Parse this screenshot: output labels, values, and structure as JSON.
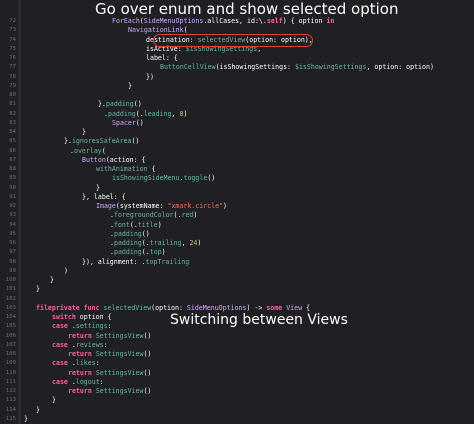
{
  "annotations": {
    "top": "Go over enum and show selected option",
    "middle": "Switching between Views"
  },
  "colors": {
    "background": "#1f1f24",
    "keyword": "#fc5fa3",
    "type": "#d0a8ff",
    "function": "#67b7a4",
    "string": "#fc6a5d",
    "number": "#d0bf69",
    "highlight": "#e0412f"
  },
  "lines": [
    {
      "n": "72",
      "tokens": [
        {
          "t": "ForEach",
          "c": "ty"
        },
        {
          "t": "(",
          "c": "pl"
        },
        {
          "t": "SideMenuOptions",
          "c": "ty"
        },
        {
          "t": ".allCases, id:\\.",
          "c": "pl"
        },
        {
          "t": "self",
          "c": "kw"
        },
        {
          "t": ") { option ",
          "c": "pl"
        },
        {
          "t": "in",
          "c": "kw"
        }
      ]
    },
    {
      "n": "73",
      "tokens": [
        {
          "t": "NavigationLink",
          "c": "ty"
        },
        {
          "t": "(",
          "c": "pl"
        }
      ]
    },
    {
      "n": "74",
      "tokens": [
        {
          "t": "destination",
          "c": "pl"
        },
        {
          "t": ": ",
          "c": "pl"
        },
        {
          "t": "selectedView",
          "c": "fn"
        },
        {
          "t": "(option: option),",
          "c": "pl"
        }
      ]
    },
    {
      "n": "75",
      "tokens": [
        {
          "t": "isActive",
          "c": "pl"
        },
        {
          "t": ": ",
          "c": "pl"
        },
        {
          "t": "$isShowingSettings",
          "c": "fn"
        },
        {
          "t": ",",
          "c": "pl"
        }
      ]
    },
    {
      "n": "76",
      "tokens": [
        {
          "t": "label",
          "c": "pl"
        },
        {
          "t": ": {",
          "c": "pl"
        }
      ]
    },
    {
      "n": "77",
      "tokens": [
        {
          "t": "ButtonCellView",
          "c": "fn"
        },
        {
          "t": "(isShowingSettings: ",
          "c": "pl"
        },
        {
          "t": "$isShowingSettings",
          "c": "fn"
        },
        {
          "t": ", option: option)",
          "c": "pl"
        }
      ]
    },
    {
      "n": "78",
      "tokens": [
        {
          "t": "})",
          "c": "pl"
        }
      ]
    },
    {
      "n": "79",
      "tokens": [
        {
          "t": "}",
          "c": "pl"
        }
      ]
    },
    {
      "n": "80",
      "tokens": []
    },
    {
      "n": "81",
      "tokens": [
        {
          "t": "}.",
          "c": "pl"
        },
        {
          "t": "padding",
          "c": "fn"
        },
        {
          "t": "()",
          "c": "pl"
        }
      ]
    },
    {
      "n": "82",
      "tokens": [
        {
          "t": ".",
          "c": "pl"
        },
        {
          "t": "padding",
          "c": "fn"
        },
        {
          "t": "(.",
          "c": "pl"
        },
        {
          "t": "leading",
          "c": "fn"
        },
        {
          "t": ", ",
          "c": "pl"
        },
        {
          "t": "0",
          "c": "nm"
        },
        {
          "t": ")",
          "c": "pl"
        }
      ]
    },
    {
      "n": "83",
      "tokens": [
        {
          "t": "Spacer",
          "c": "ty"
        },
        {
          "t": "()",
          "c": "pl"
        }
      ]
    },
    {
      "n": "84",
      "tokens": [
        {
          "t": "}",
          "c": "pl"
        }
      ]
    },
    {
      "n": "85",
      "tokens": [
        {
          "t": "}.",
          "c": "pl"
        },
        {
          "t": "ignoresSafeArea",
          "c": "fn"
        },
        {
          "t": "()",
          "c": "pl"
        }
      ]
    },
    {
      "n": "86",
      "tokens": [
        {
          "t": ".",
          "c": "pl"
        },
        {
          "t": "overlay",
          "c": "fn"
        },
        {
          "t": "(",
          "c": "pl"
        }
      ]
    },
    {
      "n": "87",
      "tokens": [
        {
          "t": "Button",
          "c": "ty"
        },
        {
          "t": "(action: {",
          "c": "pl"
        }
      ]
    },
    {
      "n": "88",
      "tokens": [
        {
          "t": "withAnimation",
          "c": "fn"
        },
        {
          "t": " {",
          "c": "pl"
        }
      ]
    },
    {
      "n": "89",
      "tokens": [
        {
          "t": "isShowingSideMenu",
          "c": "fn"
        },
        {
          "t": ".",
          "c": "pl"
        },
        {
          "t": "toggle",
          "c": "fn"
        },
        {
          "t": "()",
          "c": "pl"
        }
      ]
    },
    {
      "n": "90",
      "tokens": [
        {
          "t": "}",
          "c": "pl"
        }
      ]
    },
    {
      "n": "91",
      "tokens": [
        {
          "t": "}, label: {",
          "c": "pl"
        }
      ]
    },
    {
      "n": "92",
      "tokens": [
        {
          "t": "Image",
          "c": "ty"
        },
        {
          "t": "(systemName: ",
          "c": "pl"
        },
        {
          "t": "\"xmark.circle\"",
          "c": "st"
        },
        {
          "t": ")",
          "c": "pl"
        }
      ]
    },
    {
      "n": "93",
      "tokens": [
        {
          "t": ".",
          "c": "pl"
        },
        {
          "t": "foregroundColor",
          "c": "fn"
        },
        {
          "t": "(.",
          "c": "pl"
        },
        {
          "t": "red",
          "c": "fn"
        },
        {
          "t": ")",
          "c": "pl"
        }
      ]
    },
    {
      "n": "94",
      "tokens": [
        {
          "t": ".",
          "c": "pl"
        },
        {
          "t": "font",
          "c": "fn"
        },
        {
          "t": "(.",
          "c": "pl"
        },
        {
          "t": "title",
          "c": "fn"
        },
        {
          "t": ")",
          "c": "pl"
        }
      ]
    },
    {
      "n": "95",
      "tokens": [
        {
          "t": ".",
          "c": "pl"
        },
        {
          "t": "padding",
          "c": "fn"
        },
        {
          "t": "()",
          "c": "pl"
        }
      ]
    },
    {
      "n": "96",
      "tokens": [
        {
          "t": ".",
          "c": "pl"
        },
        {
          "t": "padding",
          "c": "fn"
        },
        {
          "t": "(.",
          "c": "pl"
        },
        {
          "t": "trailing",
          "c": "fn"
        },
        {
          "t": ", ",
          "c": "pl"
        },
        {
          "t": "24",
          "c": "nm"
        },
        {
          "t": ")",
          "c": "pl"
        }
      ]
    },
    {
      "n": "97",
      "tokens": [
        {
          "t": ".",
          "c": "pl"
        },
        {
          "t": "padding",
          "c": "fn"
        },
        {
          "t": "(.",
          "c": "pl"
        },
        {
          "t": "top",
          "c": "fn"
        },
        {
          "t": ")",
          "c": "pl"
        }
      ]
    },
    {
      "n": "98",
      "tokens": [
        {
          "t": "}), alignment: .",
          "c": "pl"
        },
        {
          "t": "topTrailing",
          "c": "fn"
        }
      ]
    },
    {
      "n": "99",
      "tokens": [
        {
          "t": ")",
          "c": "pl"
        }
      ]
    },
    {
      "n": "100",
      "tokens": [
        {
          "t": "}",
          "c": "pl"
        }
      ]
    },
    {
      "n": "101",
      "tokens": [
        {
          "t": "}",
          "c": "pl"
        }
      ]
    },
    {
      "n": "102",
      "tokens": []
    },
    {
      "n": "103",
      "tokens": [
        {
          "t": "fileprivate",
          "c": "kw"
        },
        {
          "t": " ",
          "c": "pl"
        },
        {
          "t": "func",
          "c": "kw"
        },
        {
          "t": " ",
          "c": "pl"
        },
        {
          "t": "selectedView",
          "c": "fn"
        },
        {
          "t": "(option: ",
          "c": "pl"
        },
        {
          "t": "SideMenuOptions",
          "c": "ty"
        },
        {
          "t": ") -> ",
          "c": "pl"
        },
        {
          "t": "some",
          "c": "kw"
        },
        {
          "t": " ",
          "c": "pl"
        },
        {
          "t": "View",
          "c": "ty"
        },
        {
          "t": " {",
          "c": "pl"
        }
      ]
    },
    {
      "n": "104",
      "tokens": [
        {
          "t": "switch",
          "c": "kw"
        },
        {
          "t": " option {",
          "c": "pl"
        }
      ]
    },
    {
      "n": "105",
      "tokens": [
        {
          "t": "case",
          "c": "kw"
        },
        {
          "t": " .",
          "c": "pl"
        },
        {
          "t": "settings",
          "c": "fn"
        },
        {
          "t": ":",
          "c": "pl"
        }
      ]
    },
    {
      "n": "106",
      "tokens": [
        {
          "t": "return",
          "c": "kw"
        },
        {
          "t": " ",
          "c": "pl"
        },
        {
          "t": "SettingsView",
          "c": "fn"
        },
        {
          "t": "()",
          "c": "pl"
        }
      ]
    },
    {
      "n": "107",
      "tokens": [
        {
          "t": "case",
          "c": "kw"
        },
        {
          "t": " .",
          "c": "pl"
        },
        {
          "t": "reviews",
          "c": "fn"
        },
        {
          "t": ":",
          "c": "pl"
        }
      ]
    },
    {
      "n": "108",
      "tokens": [
        {
          "t": "return",
          "c": "kw"
        },
        {
          "t": " ",
          "c": "pl"
        },
        {
          "t": "SettingsView",
          "c": "fn"
        },
        {
          "t": "()",
          "c": "pl"
        }
      ]
    },
    {
      "n": "109",
      "tokens": [
        {
          "t": "case",
          "c": "kw"
        },
        {
          "t": " .",
          "c": "pl"
        },
        {
          "t": "likes",
          "c": "fn"
        },
        {
          "t": ":",
          "c": "pl"
        }
      ]
    },
    {
      "n": "110",
      "tokens": [
        {
          "t": "return",
          "c": "kw"
        },
        {
          "t": " ",
          "c": "pl"
        },
        {
          "t": "SettingsView",
          "c": "fn"
        },
        {
          "t": "()",
          "c": "pl"
        }
      ]
    },
    {
      "n": "111",
      "tokens": [
        {
          "t": "case",
          "c": "kw"
        },
        {
          "t": " .",
          "c": "pl"
        },
        {
          "t": "logout",
          "c": "fn"
        },
        {
          "t": ":",
          "c": "pl"
        }
      ]
    },
    {
      "n": "112",
      "tokens": [
        {
          "t": "return",
          "c": "kw"
        },
        {
          "t": " ",
          "c": "pl"
        },
        {
          "t": "SettingsView",
          "c": "fn"
        },
        {
          "t": "()",
          "c": "pl"
        }
      ]
    },
    {
      "n": "113",
      "tokens": [
        {
          "t": "}",
          "c": "pl"
        }
      ]
    },
    {
      "n": "114",
      "tokens": [
        {
          "t": "}",
          "c": "pl"
        }
      ]
    },
    {
      "n": "115",
      "tokens": [
        {
          "t": "}",
          "c": "pl"
        }
      ]
    },
    {
      "n": "116",
      "tokens": []
    }
  ]
}
